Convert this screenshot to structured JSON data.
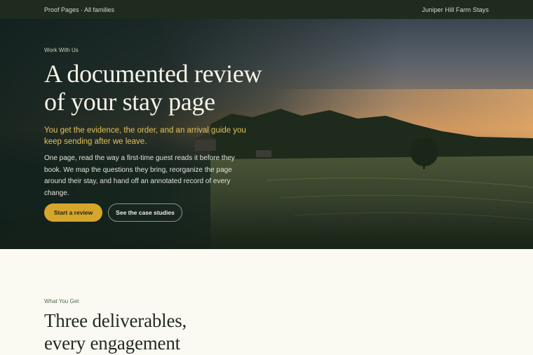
{
  "topbar": {
    "left": "Proof Pages · All families",
    "right": "Juniper Hill Farm Stays"
  },
  "hero": {
    "eyebrow": "Work With Us",
    "title": "A documented review of your stay page",
    "lead": "You get the evidence, the order, and an arrival guide you keep sending after we leave.",
    "body": "One page, read the way a first-time guest reads it before they book. We map the questions they bring, reorganize the page around their stay, and hand off an annotated record of every change.",
    "primary_button": "Start a review",
    "secondary_button": "See the case studies"
  },
  "section": {
    "eyebrow": "What You Get",
    "title": "Three deliverables, every engagement"
  },
  "colors": {
    "accent": "#d5a52c",
    "topbar": "#1f2b1f",
    "background": "#fbfaf2"
  }
}
